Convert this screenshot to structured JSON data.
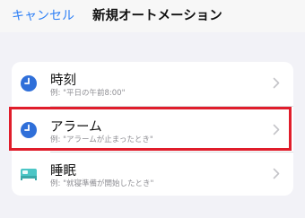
{
  "navbar": {
    "cancel_label": "キャンセル",
    "title": "新規オートメーション"
  },
  "rows": [
    {
      "title": "時刻",
      "subtitle": "例: \"平日の午前8:00\"",
      "icon": "clock-icon"
    },
    {
      "title": "アラーム",
      "subtitle": "例: \"アラームが止まったとき\"",
      "icon": "alarm-clock-icon"
    },
    {
      "title": "睡眠",
      "subtitle": "例: \"就寝準備が開始したとき\"",
      "icon": "bed-icon"
    }
  ],
  "colors": {
    "accent": "#2f80f6",
    "highlight": "#e01d2b",
    "clock": "#2f6fd9",
    "bed": "#4cc6c6"
  }
}
